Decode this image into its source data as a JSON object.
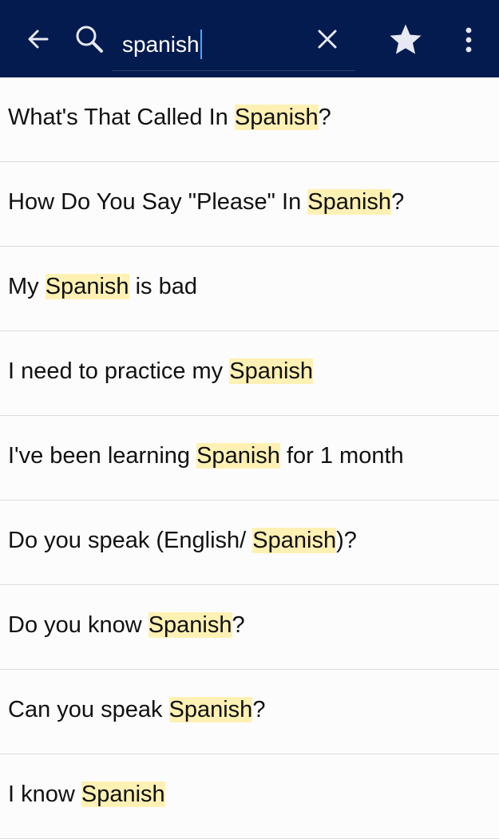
{
  "toolbar": {
    "back_icon": "arrow-left-icon",
    "search_icon": "search-icon",
    "query": "spanish",
    "clear_icon": "close-icon",
    "favorite_icon": "star-icon",
    "more_icon": "more-vert-icon",
    "background": "#041b4f"
  },
  "highlight_color": "#fff1b3",
  "results": [
    {
      "before": "What's That Called In ",
      "match": "Spanish",
      "after": "?"
    },
    {
      "before": "How Do You Say \"Please\" In ",
      "match": "Spanish",
      "after": "?"
    },
    {
      "before": "My ",
      "match": "Spanish",
      "after": " is bad"
    },
    {
      "before": "I need to practice my ",
      "match": "Spanish",
      "after": ""
    },
    {
      "before": "I've been learning ",
      "match": "Spanish",
      "after": " for 1 month"
    },
    {
      "before": "Do you speak (English/ ",
      "match": "Spanish",
      "after": ")?"
    },
    {
      "before": "Do you know ",
      "match": "Spanish",
      "after": "?"
    },
    {
      "before": "Can you speak ",
      "match": "Spanish",
      "after": "?"
    },
    {
      "before": "I know ",
      "match": "Spanish",
      "after": ""
    }
  ]
}
